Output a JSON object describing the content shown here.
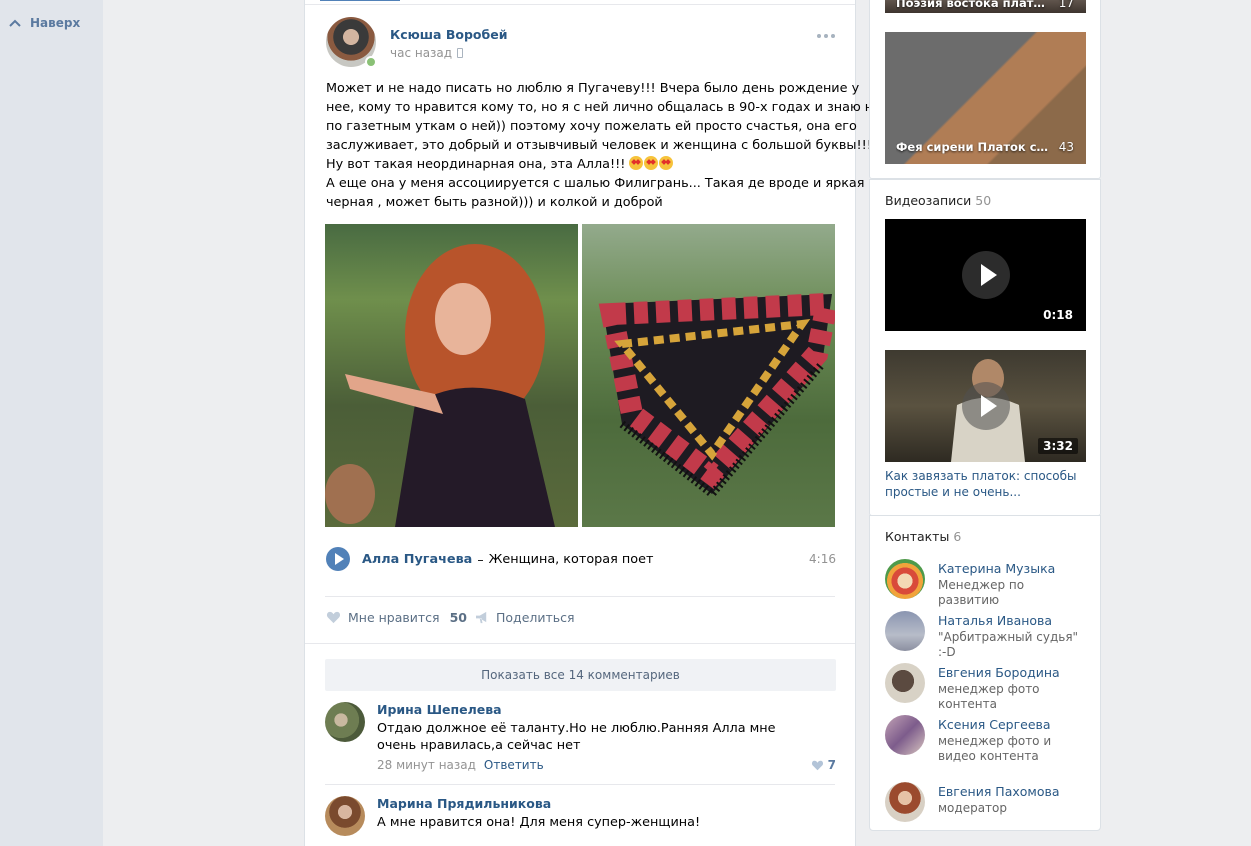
{
  "nav": {
    "to_top_label": "Наверх"
  },
  "post": {
    "author": "Ксюша Воробей",
    "time": "час назад",
    "text_lines": [
      "Может и не надо писать но люблю я Пугачеву!!! Вчера было день рождение у",
      "нее, кому то нравится кому то, но я с ней лично общалась в 90-х годах и знаю не",
      "по газетным уткам о ней)) поэтому хочу пожелать ей просто счастья, она его",
      "заслуживает, это добрый и отзывчивый человек и женщина с большой буквы!!!",
      "Ну вот такая неординарная она, эта Алла!!!",
      "А еще она у меня ассоциируется с шалью Филигрань... Такая де вроде и яркая и",
      "черная , может быть разной))) и колкой и доброй"
    ],
    "audio": {
      "artist": "Алла Пугачева",
      "dash": "–",
      "title": "Женщина, которая поет",
      "duration": "4:16"
    },
    "like_label": "Мне нравится",
    "like_count": "50",
    "share_label": "Поделиться",
    "show_comments_label": "Показать все 14 комментариев"
  },
  "comments": [
    {
      "author": "Ирина Шепелева",
      "text": "Отдаю должное её таланту.Но не люблю.Ранняя Алла мне очень нравилась,а сейчас нет",
      "time": "28 минут назад",
      "reply_label": "Ответить",
      "likes": "7"
    },
    {
      "author": "Марина Прядильникова",
      "text": "А мне нравится она! Для меня супер-женщина!"
    }
  ],
  "sidebar": {
    "albums": [
      {
        "label": "Поэзия востока платок ...",
        "count": "17"
      },
      {
        "label": "Фея сирени Платок с ш...",
        "count": "43"
      }
    ],
    "videos": {
      "header": "Видеозаписи",
      "count": "50",
      "items": [
        {
          "duration": "0:18"
        },
        {
          "duration": "3:32",
          "title": "Как завязать платок: способы простые и не очень..."
        }
      ]
    },
    "contacts": {
      "header": "Контакты",
      "count": "6",
      "items": [
        {
          "name": "Катерина Музыка",
          "role": "Менеджер по развитию"
        },
        {
          "name": "Наталья Иванова",
          "role": "\"Арбитражный судья\" :-D"
        },
        {
          "name": "Евгения Бородина",
          "role": "менеджер фото контента"
        },
        {
          "name": "Ксения Сергеева",
          "role": "менеджер фото и видео контента"
        },
        {
          "name": "Евгения Пахомова",
          "role": "модератор"
        }
      ]
    }
  },
  "colors": {
    "link": "#2a5885",
    "accent": "#5181b8",
    "page_bg": "#edeef0"
  }
}
